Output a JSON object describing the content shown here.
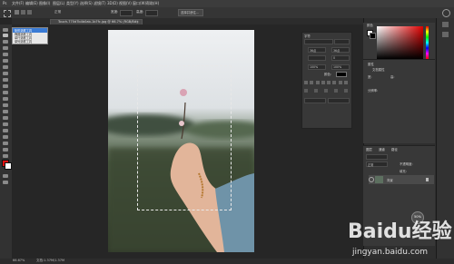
{
  "menubar": {
    "items": [
      "文件(F)",
      "编辑(E)",
      "图像(I)",
      "图层(L)",
      "类型(Y)",
      "选择(S)",
      "滤镜(T)",
      "3D(D)",
      "视图(V)",
      "窗口(W)",
      "帮助(H)"
    ]
  },
  "optionsbar": {
    "mode_label": "正常",
    "width_label": "宽度:",
    "height_label": "高度:",
    "select_mask_label": "选择并遮住..."
  },
  "document": {
    "tab_title": "Touch-770d7b4b0ab-1b7fc.jpg @ 66.7% (RGB/8#)"
  },
  "tool_flyout": {
    "items": [
      "矩形选框工具",
      "椭圆选框工具",
      "单行选框工具",
      "单列选框工具"
    ],
    "selected_index": 0
  },
  "character_panel": {
    "title": "字符",
    "font_size": "36点",
    "leading": "36点",
    "tracking": "0",
    "scale_v": "100%",
    "scale_h": "100%",
    "color_label": "颜色:"
  },
  "color_panel": {
    "title": "颜色",
    "fg_color": "#ffffff",
    "bg_color": "#000000"
  },
  "properties_panel": {
    "title": "属性",
    "subtitle": "文档属性",
    "w_label": "宽:",
    "h_label": "高:",
    "res_label": "分辨率:"
  },
  "layers_panel": {
    "tabs": [
      "图层",
      "通道",
      "路径"
    ],
    "blend_mode": "正常",
    "opacity_label": "不透明度:",
    "fill_label": "填充:",
    "layer_name": "背景"
  },
  "status": {
    "zoom": "66.67%",
    "doc_info": "文档:1.37M/1.37M"
  },
  "zoom_badge": "50%",
  "watermark": {
    "text": "Baidu经验",
    "url": "jingyan.baidu.com"
  },
  "colors": {
    "app_bg": "#262626",
    "panel_bg": "#383838",
    "accent": "#3a7bd5"
  }
}
